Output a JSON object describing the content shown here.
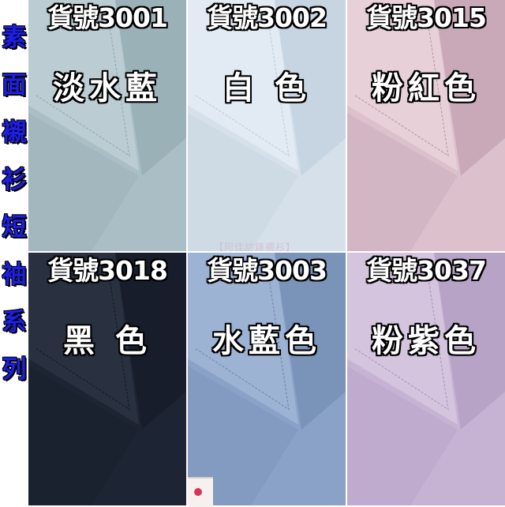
{
  "sidebar": {
    "chars": [
      "素",
      "面",
      "襯",
      "衫",
      "短",
      "袖",
      "系",
      "列"
    ],
    "color": "#1d1fe6"
  },
  "tiles": [
    {
      "code": "貨號3001",
      "name": "淡水藍",
      "fabric": "#a9bec5",
      "shade": "#8fa6ad",
      "light": "#c2d2d7"
    },
    {
      "code": "貨號3002",
      "name": "白 色",
      "fabric": "#d5e0ea",
      "shade": "#bccbd8",
      "light": "#e6eef5"
    },
    {
      "code": "貨號3015",
      "name": "粉紅色",
      "fabric": "#dcc1cc",
      "shade": "#b996a7",
      "light": "#ebd4dc"
    },
    {
      "code": "貨號3018",
      "name": "黑 色",
      "fabric": "#1d2433",
      "shade": "#121724",
      "light": "#2e3546"
    },
    {
      "code": "貨號3003",
      "name": "水藍色",
      "fabric": "#8aa2c7",
      "shade": "#6e86ad",
      "light": "#a3b8d8"
    },
    {
      "code": "貨號3037",
      "name": "粉紫色",
      "fabric": "#c6b3d4",
      "shade": "#a995ba",
      "light": "#d8c9e2"
    }
  ],
  "watermark": "【阿佳訪錶襯衫】"
}
